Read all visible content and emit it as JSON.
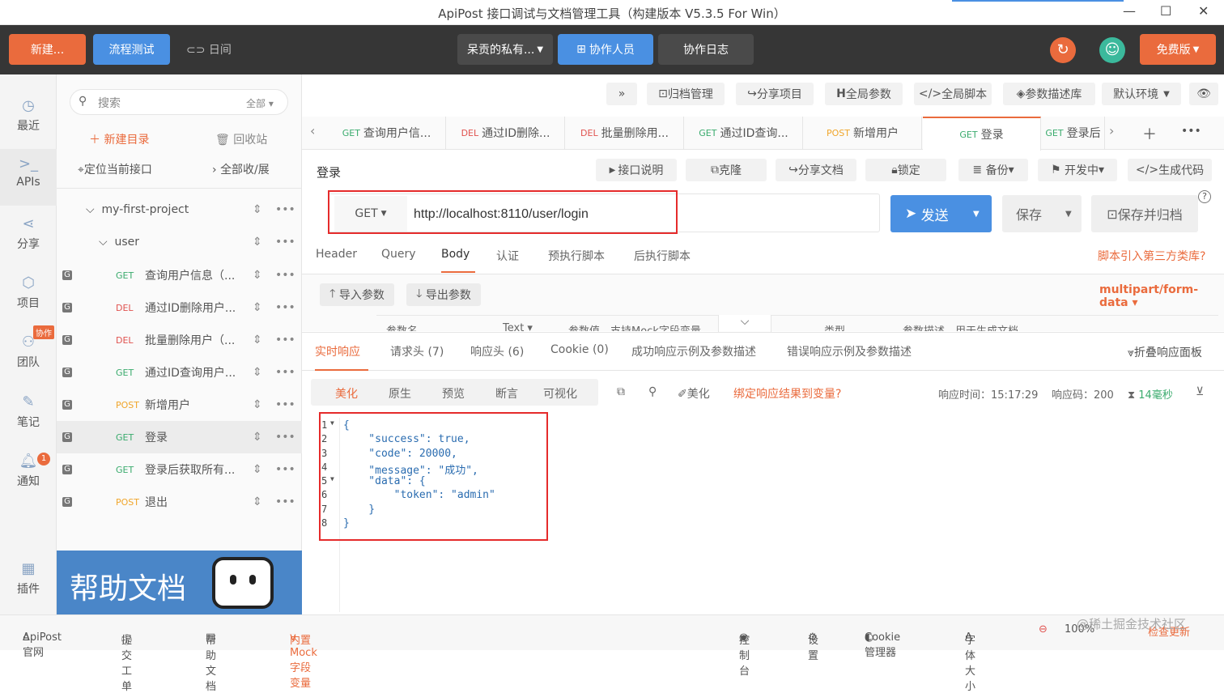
{
  "window": {
    "title": "ApiPost 接口调试与文档管理工具（构建版本 V5.3.5 For Win）"
  },
  "topbar": {
    "new_btn": "新建...",
    "flow_btn": "流程测试",
    "night_label": "日间",
    "project_select": "呆贡的私有...",
    "collab_btn": "协作人员",
    "collab_log": "协作日志",
    "version_btn": "免费版"
  },
  "sidebar": {
    "items": [
      {
        "label": "最近"
      },
      {
        "label": "APIs"
      },
      {
        "label": "分享"
      },
      {
        "label": "项目"
      },
      {
        "label": "团队",
        "badge": "协作"
      },
      {
        "label": "笔记"
      },
      {
        "label": "通知",
        "badge": "1"
      },
      {
        "label": "插件"
      }
    ]
  },
  "tree": {
    "search_placeholder": "搜索",
    "filter": "全部",
    "new_dir": "新建目录",
    "recycle": "回收站",
    "locate": "定位当前接口",
    "collapse": "全部收/展",
    "project": "my-first-project",
    "folder": "user",
    "apis": [
      {
        "method": "GET",
        "name": "查询用户信息（..."
      },
      {
        "method": "DEL",
        "name": "通过ID删除用户..."
      },
      {
        "method": "DEL",
        "name": "批量删除用户（..."
      },
      {
        "method": "GET",
        "name": "通过ID查询用户..."
      },
      {
        "method": "POST",
        "name": "新增用户"
      },
      {
        "method": "GET",
        "name": "登录"
      },
      {
        "method": "GET",
        "name": "登录后获取所有..."
      },
      {
        "method": "POST",
        "name": "退出"
      }
    ],
    "help_banner": "帮助文档"
  },
  "toolbar": {
    "expand": "»",
    "archive": "归档管理",
    "share_project": "分享项目",
    "global_params": "全局参数",
    "global_script": "全局脚本",
    "param_lib": "参数描述库",
    "env": "默认环境"
  },
  "tabs": [
    {
      "method": "GET",
      "name": "查询用户信..."
    },
    {
      "method": "DEL",
      "name": "通过ID删除..."
    },
    {
      "method": "DEL",
      "name": "批量删除用..."
    },
    {
      "method": "GET",
      "name": "通过ID查询..."
    },
    {
      "method": "POST",
      "name": "新增用户"
    },
    {
      "method": "GET",
      "name": "登录"
    },
    {
      "method": "GET",
      "name": "登录后"
    }
  ],
  "api": {
    "name": "登录",
    "doc": "接口说明",
    "clone": "克隆",
    "share_doc": "分享文档",
    "lock": "锁定",
    "backup": "备份",
    "status": "开发中",
    "gen_code": "生成代码",
    "method": "GET",
    "url": "http://localhost:8110/user/login",
    "send": "发送",
    "save": "保存",
    "save_archive": "保存并归档"
  },
  "req_tabs": [
    "Header",
    "Query",
    "Body",
    "认证",
    "预执行脚本",
    "后执行脚本"
  ],
  "third_lib": "脚本引入第三方类库?",
  "body": {
    "import": "导入参数",
    "export": "导出参数",
    "content_type": "multipart/form-data",
    "col_name": "参数名",
    "col_type": "Text",
    "col_value": "参数值，支持Mock字段变量",
    "col_kind": "类型",
    "col_desc": "参数描述，用于生成文档"
  },
  "resp_tabs": [
    "实时响应",
    "请求头 (7)",
    "响应头 (6)",
    "Cookie (0)",
    "成功响应示例及参数描述",
    "错误响应示例及参数描述"
  ],
  "fold": "折叠响应面板",
  "resp_view": {
    "modes": [
      "美化",
      "原生",
      "预览",
      "断言",
      "可视化"
    ],
    "beautify": "美化",
    "bind_var": "绑定响应结果到变量?",
    "time_label": "响应时间：",
    "time": "15:17:29",
    "code_label": "响应码：",
    "code": "200",
    "duration": "14毫秒"
  },
  "response_lines": [
    "{",
    "    \"success\": true,",
    "    \"code\": 20000,",
    "    \"message\": \"成功\",",
    "    \"data\": {",
    "        \"token\": \"admin\"",
    "    }",
    "}"
  ],
  "status": {
    "official": "ApiPost官网",
    "ticket": "提交工单",
    "help": "帮助文档",
    "mock": "内置Mock字段变量",
    "console": "控制台",
    "settings": "设置",
    "cookie": "Cookie管理器",
    "font": "字体大小",
    "zoom": "100%",
    "update": "检查更新",
    "watermark": "@稀土掘金技术社区"
  }
}
